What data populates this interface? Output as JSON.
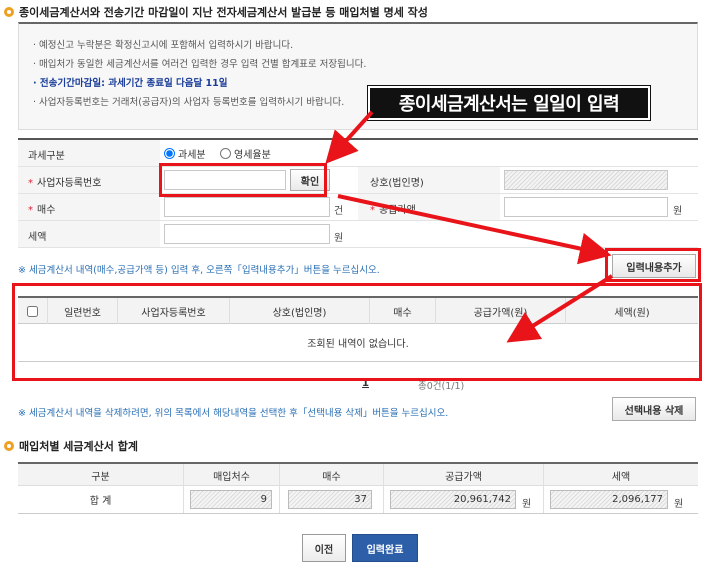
{
  "section1": {
    "title": "종이세금계산서와 전송기간 마감일이 지난 전자세금계산서 발급분 등 매입처별 명세 작성"
  },
  "notice": {
    "lines": [
      "예정신고 누락분은 확정신고시에 포함해서 입력하시기 바랍니다.",
      "매입처가 동일한 세금계산서를 여러건 입력한 경우 입력 건별 합계표로 저장됩니다.",
      "전송기간마감일: 과세기간 종료일 다음달 11일",
      "사업자등록번호는 거래처(공급자)의 사업자 등록번호를 입력하시기 바랍니다."
    ]
  },
  "callout": "종이세금계산서는 일일이 입력",
  "form": {
    "tax_type_label": "과세구분",
    "tax_options": [
      "과세분",
      "영세율분"
    ],
    "tax_selected": "과세분",
    "bizno_label": "사업자등록번호",
    "bizno_value": "",
    "confirm_button": "확인",
    "company_label": "상호(법인명)",
    "count_label": "매수",
    "count_unit": "건",
    "supply_label": "공급가액",
    "supply_unit": "원",
    "tax_label": "세액",
    "tax_unit": "원"
  },
  "hint_add": "※ 세금계산서 내역(매수,공급가액 등) 입력 후, 오른쪽「입력내용추가」버튼을 누르십시오.",
  "add_button": "입력내용추가",
  "table": {
    "columns": [
      "일련번호",
      "사업자등록번호",
      "상호(법인명)",
      "매수",
      "공급가액(원)",
      "세액(원)"
    ],
    "empty_text": "조회된 내역이 없습니다."
  },
  "pagination": {
    "current": "1",
    "summary": "총0건(1/1)"
  },
  "hint_delete": "※ 세금계산서 내역을 삭제하려면, 위의 목록에서 해당내역을 선택한 후「선택내용 삭제」버튼을 누르십시오.",
  "delete_button": "선택내용 삭제",
  "section2": {
    "title": "매입처별 세금계산서 합계"
  },
  "summary": {
    "columns": [
      "구분",
      "매입처수",
      "매수",
      "공급가액",
      "세액"
    ],
    "row_label": "합 계",
    "vendor_count": "9",
    "count": "37",
    "supply_amount": "20,961,742",
    "tax_amount": "2,096,177",
    "unit": "원"
  },
  "buttons": {
    "prev": "이전",
    "complete": "입력완료"
  },
  "colors": {
    "accent_red": "#e8141a",
    "primary_blue": "#2d5ea8",
    "link_blue": "#1a3d99"
  }
}
